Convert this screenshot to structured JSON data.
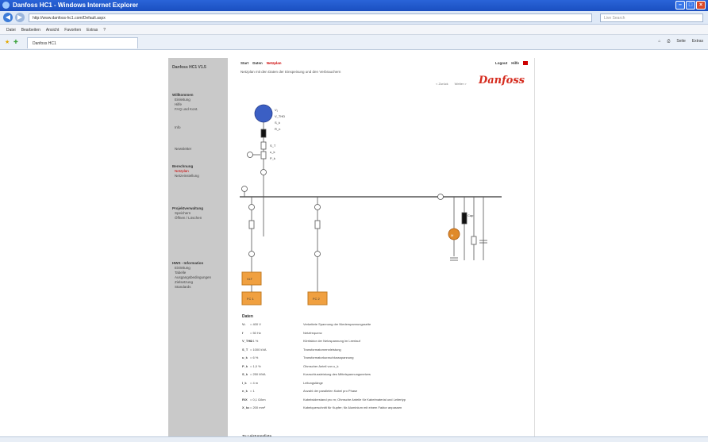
{
  "browser": {
    "title": "Danfoss HC1 - Windows Internet Explorer",
    "url": "http://www.danfoss-hc1.com/Default.aspx",
    "search_placeholder": "Live Search",
    "menu": [
      "Datei",
      "Bearbeiten",
      "Ansicht",
      "Favoriten",
      "Extras",
      "?"
    ],
    "fav_tab": "Danfoss HC1",
    "commands": [
      "Seite",
      "Extras"
    ]
  },
  "sidebar": {
    "brand": "Danfoss HC1 V1.5",
    "groups": [
      {
        "title": "Willkommen",
        "items": [
          "Einleitung",
          "Hilfe",
          "FAQ und Kont."
        ]
      },
      {
        "title": "",
        "items": [
          "Info"
        ]
      },
      {
        "title": "",
        "items": [
          "Newsletter"
        ]
      },
      {
        "title": "Berechnung",
        "items": [
          "Netzplan",
          "Netzeinstellung"
        ]
      },
      {
        "title": "Projektverwaltung",
        "items": [
          "Speichern",
          "Öffnen / Löschen"
        ]
      },
      {
        "title": "HWS - Information",
        "items": [
          "Einleitung",
          "Tabelle",
          "Ausgangsbedingungen",
          "Zielsetzung",
          "Standards"
        ]
      }
    ],
    "active_item": "Netzplan"
  },
  "content": {
    "topnav": [
      "Start",
      "Daten",
      "Netzplan"
    ],
    "topnav_active": "Netzplan",
    "toplinks": [
      "Logout",
      "Hilfe"
    ],
    "intro": "Netzplan mit den Daten der Einspeisung und den Verbrauchern",
    "subnav": [
      "< Zurück",
      "Weiter >"
    ],
    "logo": "Danfoss",
    "diagram": {
      "gen_labels": [
        "V₁",
        "V_THD",
        "S_k",
        "R_n"
      ],
      "trafo_labels": [
        "S_T",
        "u_k",
        "P_k"
      ],
      "feeders": [
        {
          "box1": "VLT",
          "box2": "FC 1"
        },
        {
          "box2": "FC 2"
        }
      ],
      "cap_label": "Cap",
      "motor_label": "M"
    },
    "legend_title": "Daten",
    "legend": [
      {
        "sym": "V₁",
        "val": "= 400 V",
        "desc": "Verkettete Spannung der Niederspannungsseite"
      },
      {
        "sym": "f",
        "val": "= 50 Hz",
        "desc": "Netzfrequenz"
      },
      {
        "sym": "V_THD",
        "val": "= 1 %",
        "desc": "Klirrfaktor der Netzspannung im Leerlauf"
      },
      {
        "sym": "S_T",
        "val": "= 1000 kVA",
        "desc": "Transformatornennleistung"
      },
      {
        "sym": "u_k",
        "val": "= 6 %",
        "desc": "Transformatorkurzschlussspannung"
      },
      {
        "sym": "P_k",
        "val": "= 1,0 %",
        "desc": "Ohmscher Anteil von u_k"
      },
      {
        "sym": "S_k",
        "val": "= 250 MVA",
        "desc": "Kurzschlussleistung des Mittelspannungsnetzes"
      },
      {
        "sym": "l_k",
        "val": "= 4 m",
        "desc": "Leitungslänge"
      },
      {
        "sym": "n_k",
        "val": "= 1",
        "desc": "Anzahl der parallelen Kabel pro Phase"
      },
      {
        "sym": "R/X",
        "val": "= 0,1 Ω/km",
        "desc": "Kabelwiderstand pro m; Ohmsche Anteile für Kabelmaterial und Leitertyp"
      },
      {
        "sym": "X_kc",
        "val": "= 200 mm²",
        "desc": "Kabelquerschnitt für Kupfer; für Aluminium mit einem Faktor anpassen"
      }
    ],
    "footer_link": "Zu Leistungsliste"
  },
  "colors": {
    "accent": "#d52b1e",
    "motor": "#e08a2a",
    "generator": "#3b5fc4",
    "box": "#f0a040"
  }
}
